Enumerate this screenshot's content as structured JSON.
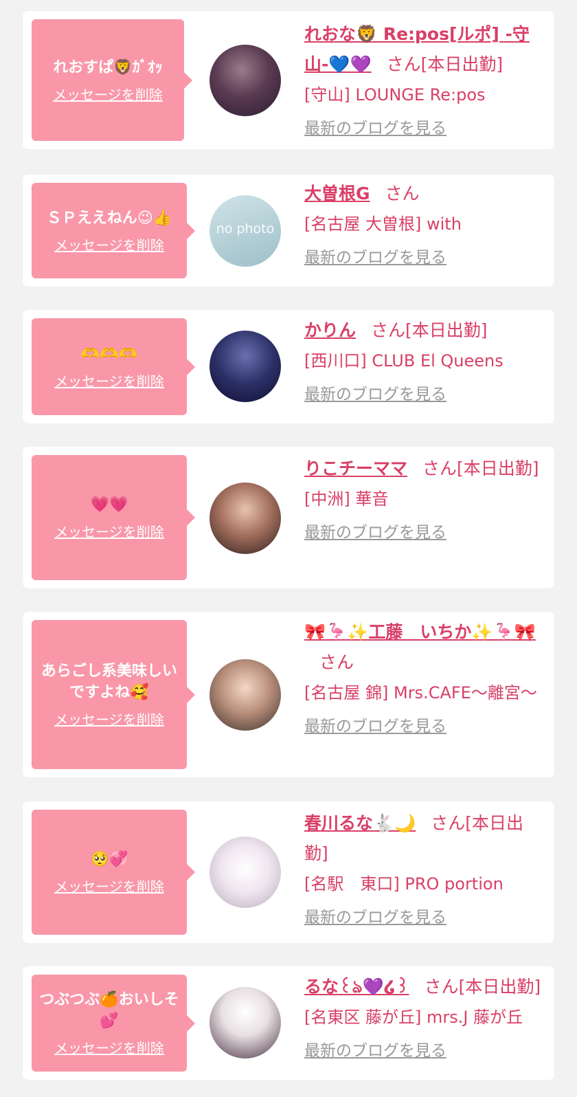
{
  "delete_label": "メッセージを削除",
  "blog_label": "最新のブログを見る",
  "honorific": "さん",
  "no_photo_text": "no photo",
  "items": [
    {
      "message": "れおすぱ🦁ｶﾞｵｯ",
      "name": "れおな🦁 Re:pos[ルポ] -守山-💙💜",
      "status": "[本日出勤]",
      "shop": "[守山] LOUNGE Re:pos",
      "avatar_colors": [
        "#7a5a6a",
        "#2d2340"
      ]
    },
    {
      "message": "ＳＰええねん😉👍",
      "name": "大曽根G",
      "status": "",
      "shop": "[名古屋 大曽根] with",
      "avatar_colors": [
        "#b9d5dc",
        "#8fb3bd"
      ]
    },
    {
      "message": "🫶🫶🫶",
      "name": "かりん",
      "status": "[本日出勤]",
      "shop": "[西川口] CLUB El Queens",
      "avatar_colors": [
        "#3a3f7a",
        "#111533"
      ]
    },
    {
      "message": "💗💗",
      "name": "りこチーママ",
      "status": "[本日出勤]",
      "shop": "[中洲] 華音",
      "avatar_colors": [
        "#d7a58c",
        "#3b2421"
      ]
    },
    {
      "message": "あらごし系美味しいですよね🥰",
      "name": "🎀🦩✨工藤　いちか✨🦩🎀",
      "status": "",
      "shop": "[名古屋 錦] Mrs.CAFE〜離宮〜",
      "avatar_colors": [
        "#e9c9b4",
        "#4a3a35"
      ]
    },
    {
      "message": "🥺💞",
      "name": "春川るな🐇🌙",
      "status": "[本日出勤]",
      "shop": "[名駅　東口] PRO portion",
      "avatar_colors": [
        "#f4eef4",
        "#c7b8c9"
      ]
    },
    {
      "message": "つぶつぶ🍊おいしそ💕",
      "name": "るな꒰ঌ💜໒꒱",
      "status": "[本日出勤]",
      "shop": "[名東区 藤が丘] mrs.J 藤が丘",
      "avatar_colors": [
        "#f1ecec",
        "#3d2c40"
      ]
    }
  ]
}
